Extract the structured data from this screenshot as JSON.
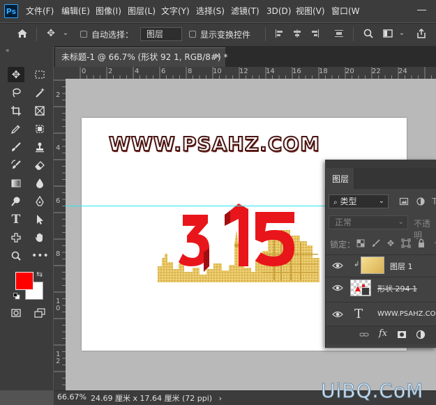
{
  "app": {
    "logo_text": "Ps"
  },
  "menu": [
    "文件(F)",
    "编辑(E)",
    "图像(I)",
    "图层(L)",
    "文字(Y)",
    "选择(S)",
    "滤镜(T)",
    "3D(D)",
    "视图(V)",
    "窗口(W"
  ],
  "options_bar": {
    "auto_select_label": "自动选择：",
    "layer_select_value": "图层",
    "show_transform_label": "显示变换控件"
  },
  "document": {
    "tab_title": "未标题-1 @ 66.7% (形状 92 1, RGB/8#) *",
    "close_glyph": "×"
  },
  "rulers": {
    "h_labels": [
      "0",
      "2",
      "4",
      "6",
      "8",
      "10",
      "12",
      "14",
      "16",
      "18",
      "20",
      "22",
      "24"
    ],
    "v_labels": [
      "2",
      "4",
      "6",
      "8",
      "1",
      "0",
      "1",
      "2"
    ]
  },
  "canvas_art": {
    "watermark_text": "WWW.PSAHZ.COM",
    "number_text": "315",
    "accent_color": "#e8161b",
    "gold_color": "#e6c25a"
  },
  "status": {
    "zoom": "66.67%",
    "doc_info": "24.69 厘米 x 17.64 厘米 (72 ppi)",
    "arrow": "›"
  },
  "site_watermark": "UiBQ.CoM",
  "layers_panel": {
    "tab_label": "图层",
    "filter_label": "类型",
    "blend_mode": "正常",
    "opacity_label": "不透明",
    "lock_label": "锁定：",
    "layers": [
      {
        "name": "图层 1",
        "type": "raster"
      },
      {
        "name": "形状 294 1",
        "type": "shape"
      },
      {
        "name": "WWW.PSAHZ.COM",
        "type": "text"
      }
    ],
    "type_icon_glyph": "T"
  },
  "colors": {
    "foreground": "#ff0000",
    "background": "#ffffff"
  }
}
